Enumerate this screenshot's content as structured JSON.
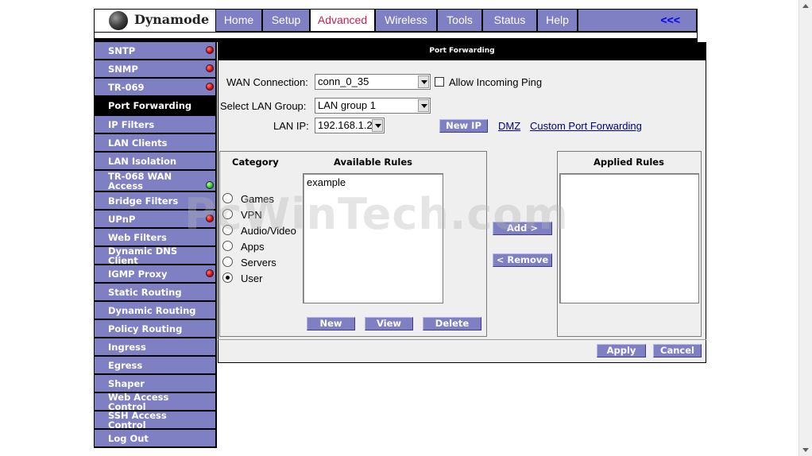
{
  "brand": {
    "name": "Dynamode"
  },
  "nav": {
    "tabs": [
      {
        "label": "Home"
      },
      {
        "label": "Setup"
      },
      {
        "label": "Advanced",
        "active": true
      },
      {
        "label": "Wireless"
      },
      {
        "label": "Tools"
      },
      {
        "label": "Status"
      },
      {
        "label": "Help"
      }
    ],
    "back_label": "<<<"
  },
  "sidebar": {
    "items": [
      {
        "label": "SNTP",
        "status": "red"
      },
      {
        "label": "SNMP",
        "status": "red"
      },
      {
        "label": "TR-069",
        "status": "red"
      },
      {
        "label": "Port Forwarding",
        "active": true
      },
      {
        "label": "IP Filters"
      },
      {
        "label": "LAN Clients"
      },
      {
        "label": "LAN Isolation"
      },
      {
        "label": "TR-068 WAN Access",
        "status": "green"
      },
      {
        "label": "Bridge Filters"
      },
      {
        "label": "UPnP",
        "status": "red"
      },
      {
        "label": "Web Filters"
      },
      {
        "label": "Dynamic DNS Client"
      },
      {
        "label": "IGMP Proxy",
        "status": "red"
      },
      {
        "label": "Static Routing"
      },
      {
        "label": "Dynamic Routing"
      },
      {
        "label": "Policy Routing"
      },
      {
        "label": "Ingress"
      },
      {
        "label": "Egress"
      },
      {
        "label": "Shaper"
      },
      {
        "label": "Web Access Control"
      },
      {
        "label": "SSH Access Control"
      },
      {
        "label": "Log Out"
      }
    ]
  },
  "panel": {
    "title": "Port Forwarding",
    "wan_connection_label": "WAN Connection:",
    "wan_connection_value": "conn_0_35",
    "allow_ping_label": "Allow Incoming Ping",
    "allow_ping_checked": false,
    "lan_group_label": "Select LAN Group:",
    "lan_group_value": "LAN group 1",
    "lan_ip_label": "LAN IP:",
    "lan_ip_value": "192.168.1.2",
    "new_ip_button": "New IP",
    "dmz_link": "DMZ",
    "custom_link": "Custom Port Forwarding",
    "category_header": "Category",
    "available_header": "Available Rules",
    "applied_header": "Applied Rules",
    "categories": [
      {
        "label": "Games",
        "selected": false
      },
      {
        "label": "VPN",
        "selected": false
      },
      {
        "label": "Audio/Video",
        "selected": false
      },
      {
        "label": "Apps",
        "selected": false
      },
      {
        "label": "Servers",
        "selected": false
      },
      {
        "label": "User",
        "selected": true
      }
    ],
    "available_rules": [
      "example"
    ],
    "applied_rules": [],
    "add_button": "Add >",
    "remove_button": "< Remove",
    "new_button": "New",
    "view_button": "View",
    "delete_button": "Delete",
    "apply_button": "Apply",
    "cancel_button": "Cancel"
  },
  "watermark": "PcWinTech.com",
  "colors": {
    "accent": "#7f7fc3",
    "active_tab_text": "#c8204e",
    "panel_bg": "#efefef",
    "status_red": "#e00000",
    "status_green": "#20c020"
  }
}
